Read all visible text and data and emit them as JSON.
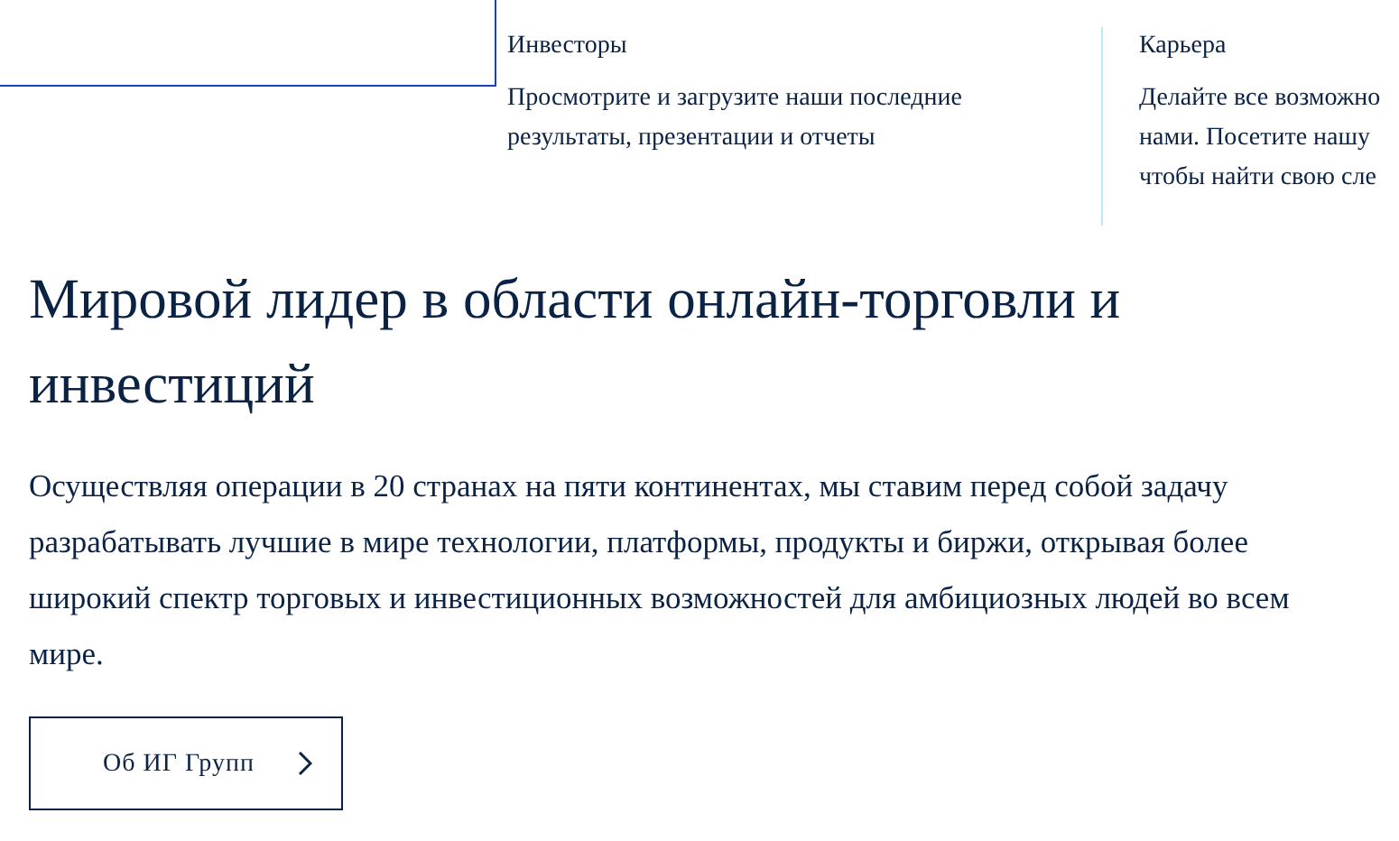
{
  "top_links": [
    {
      "title": "Инвесторы",
      "lines": [
        "Просмотрите и загрузите наши последние",
        "результаты, презентации и отчеты"
      ]
    },
    {
      "title": "Карьера",
      "lines": [
        "Делайте все возможно",
        "нами. Посетите нашу",
        "чтобы найти свою сле"
      ]
    }
  ],
  "hero": {
    "heading": "Мировой лидер в области онлайн-торговли и инвестиций",
    "text": "Осуществляя операции в 20 странах на пяти континентах, мы ставим перед собой задачу разрабатывать лучшие в мире технологии, платформы, продукты и биржи, открывая более широкий спектр торговых и инвестиционных возможностей для амбициозных людей во всем мире.",
    "button": "Об ИГ Групп"
  }
}
